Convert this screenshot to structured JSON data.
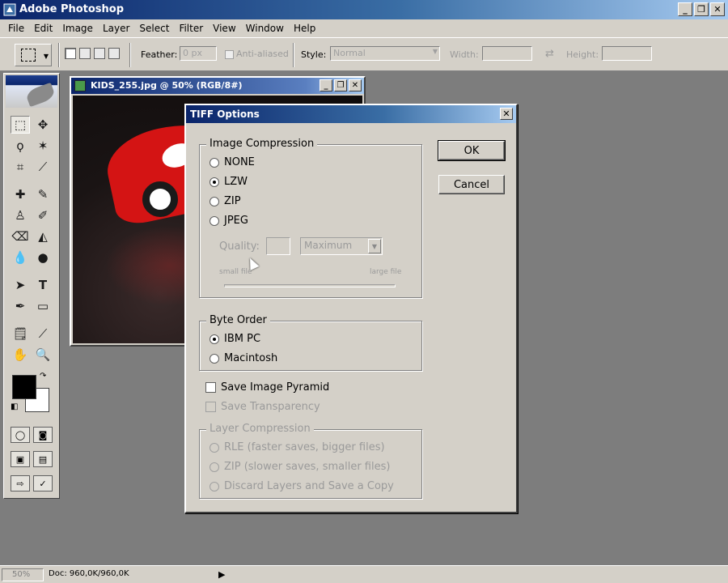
{
  "app": {
    "title": "Adobe Photoshop",
    "min": "_",
    "restore": "❐",
    "close": "✕"
  },
  "menu": [
    "File",
    "Edit",
    "Image",
    "Layer",
    "Select",
    "Filter",
    "View",
    "Window",
    "Help"
  ],
  "options": {
    "feather_label": "Feather:",
    "feather_value": "0 px",
    "antialiased": "Anti-aliased",
    "style_label": "Style:",
    "style_value": "Normal",
    "width_label": "Width:",
    "height_label": "Height:",
    "swap_glyph": "⇄"
  },
  "document": {
    "title": "KIDS_255.jpg @ 50% (RGB/8#)"
  },
  "dialog": {
    "title": "TIFF Options",
    "close": "✕",
    "ok": "OK",
    "cancel": "Cancel",
    "image_compression": {
      "legend": "Image Compression",
      "options": [
        "NONE",
        "LZW",
        "ZIP",
        "JPEG"
      ],
      "selected": "LZW",
      "quality_label": "Quality:",
      "quality_value": "Maximum",
      "small_file": "small file",
      "large_file": "large file"
    },
    "byte_order": {
      "legend": "Byte Order",
      "options": [
        "IBM PC",
        "Macintosh"
      ],
      "selected": "IBM PC"
    },
    "save_image_pyramid": "Save Image Pyramid",
    "save_transparency": "Save Transparency",
    "layer_compression": {
      "legend": "Layer Compression",
      "options": [
        "RLE (faster saves, bigger files)",
        "ZIP (slower saves, smaller files)",
        "Discard Layers and Save a Copy"
      ]
    }
  },
  "status": {
    "zoom": "50%",
    "doc_info": "Doc: 960,0K/960,0K",
    "arrow": "▶"
  },
  "colors": {
    "title_bar": "#0a246a",
    "chrome": "#d4d0c8",
    "workspace": "#7d7d7d",
    "car_red": "#d41414"
  }
}
